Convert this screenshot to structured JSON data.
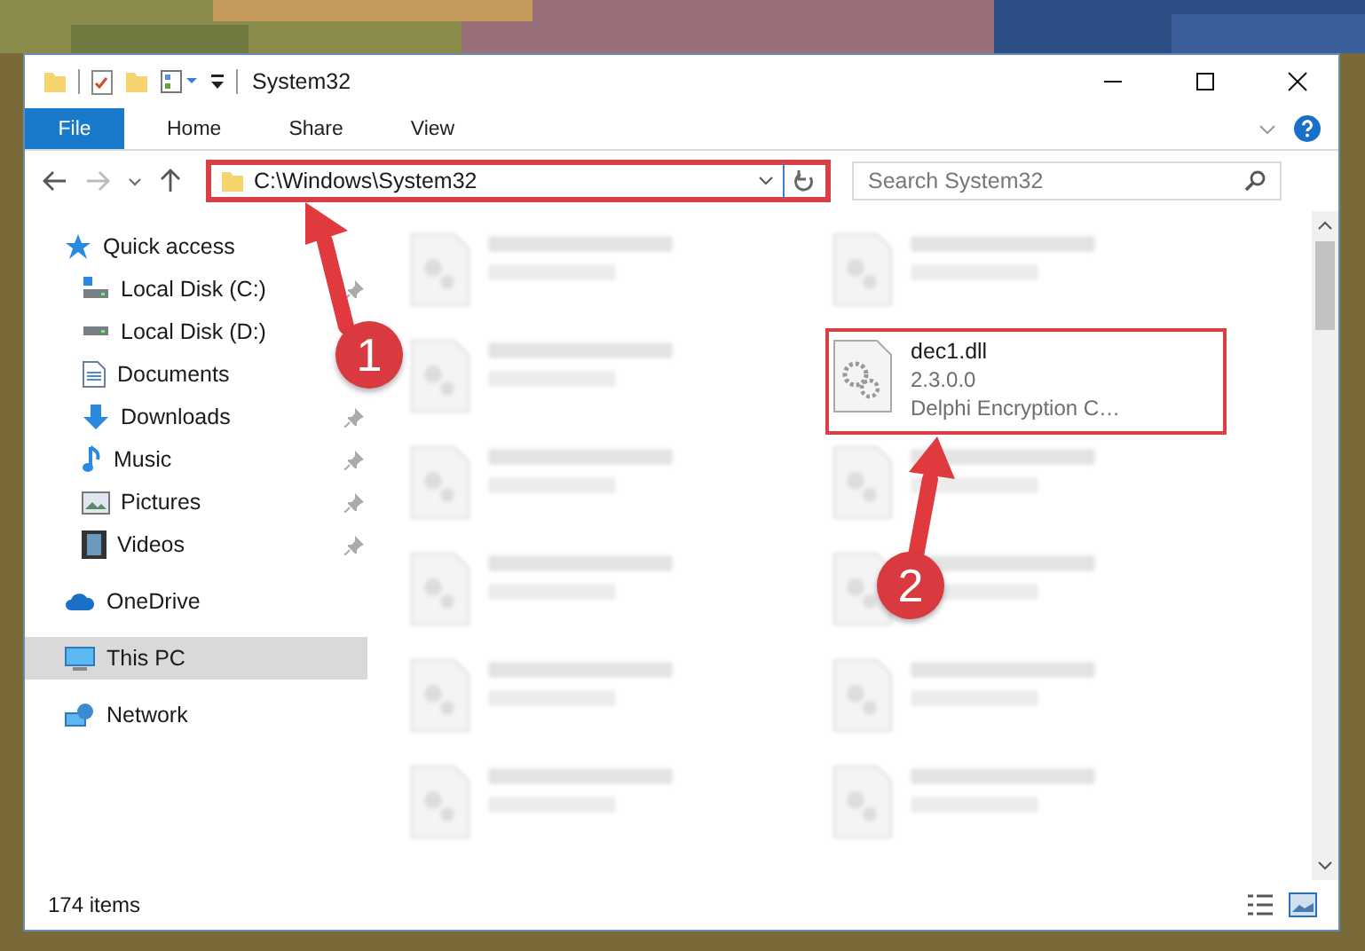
{
  "window": {
    "title": "System32"
  },
  "ribbon_tabs": [
    {
      "label": "File",
      "kind": "file"
    },
    {
      "label": "Home",
      "kind": "tab"
    },
    {
      "label": "Share",
      "kind": "tab"
    },
    {
      "label": "View",
      "kind": "tab"
    }
  ],
  "address": {
    "path": "C:\\Windows\\System32",
    "highlighted": true
  },
  "search": {
    "placeholder": "Search System32"
  },
  "sidebar": {
    "items": [
      {
        "label": "Quick access",
        "kind": "quick",
        "selected": false,
        "children": [
          {
            "label": "Local Disk (C:)",
            "kind": "windrive",
            "pinned": true,
            "selected": false
          },
          {
            "label": "Local Disk (D:)",
            "kind": "drive",
            "selected": false
          },
          {
            "label": "Documents",
            "kind": "documents",
            "selected": false
          },
          {
            "label": "Downloads",
            "kind": "downloads",
            "pinned": true,
            "selected": false
          },
          {
            "label": "Music",
            "kind": "music",
            "pinned": true,
            "selected": false
          },
          {
            "label": "Pictures",
            "kind": "pictures",
            "pinned": true,
            "selected": false
          },
          {
            "label": "Videos",
            "kind": "videos",
            "pinned": true,
            "selected": false
          }
        ]
      },
      {
        "label": "OneDrive",
        "kind": "onedrive",
        "selected": false
      },
      {
        "label": "This PC",
        "kind": "pc",
        "selected": true
      },
      {
        "label": "Network",
        "kind": "network",
        "selected": false
      }
    ]
  },
  "files": [
    {
      "kind": "blurred"
    },
    {
      "kind": "blurred"
    },
    {
      "kind": "blurred"
    },
    {
      "kind": "file",
      "name": "dec1.dll",
      "details": [
        "2.3.0.0",
        "Delphi Encryption C…"
      ],
      "highlighted": true
    },
    {
      "kind": "blurred"
    },
    {
      "kind": "blurred"
    },
    {
      "kind": "blurred"
    },
    {
      "kind": "blurred"
    },
    {
      "kind": "blurred"
    },
    {
      "kind": "blurred"
    },
    {
      "kind": "blurred"
    },
    {
      "kind": "blurred"
    }
  ],
  "status_bar": {
    "item_count": "174 items"
  },
  "annotations": [
    {
      "number": "1"
    },
    {
      "number": "2"
    }
  ]
}
